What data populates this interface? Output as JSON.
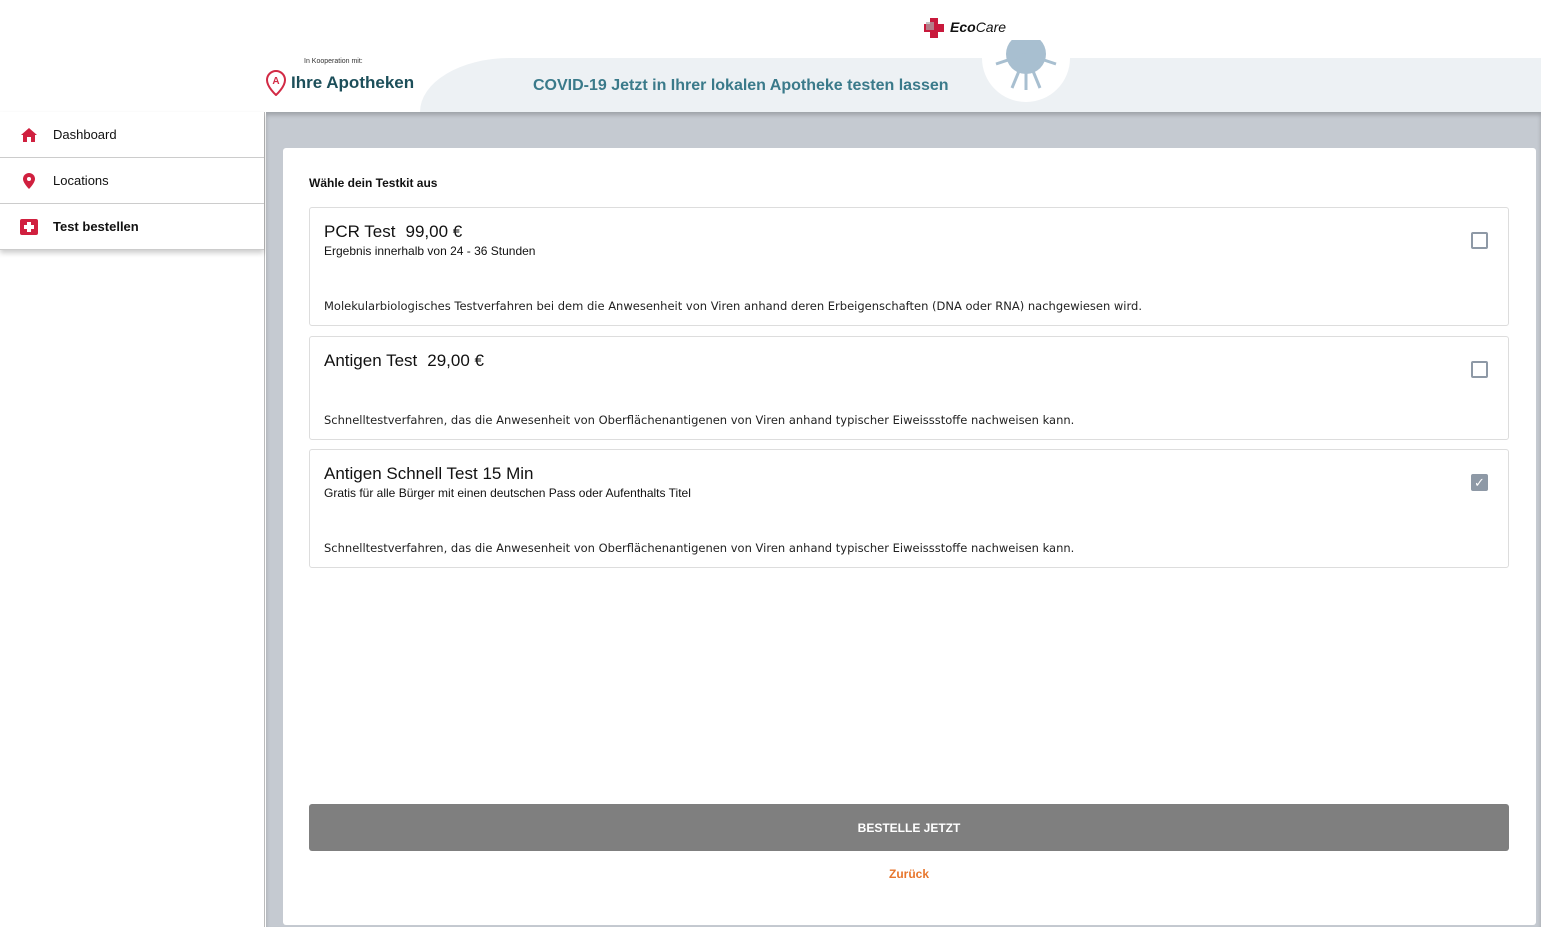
{
  "header": {
    "brand": "Eco",
    "brand2": "Care",
    "coop": "In Kooperation mit:",
    "partner": "Ihre Apotheken",
    "slogan": "COVID-19 Jetzt in Ihrer lokalen Apotheke testen lassen"
  },
  "sidebar": {
    "items": [
      {
        "label": "Dashboard"
      },
      {
        "label": "Locations"
      },
      {
        "label": "Test bestellen"
      }
    ]
  },
  "main": {
    "heading": "Wähle dein Testkit aus",
    "options": [
      {
        "name": "PCR Test",
        "price": "99,00 €",
        "subtitle": "Ergebnis innerhalb von 24 - 36 Stunden",
        "desc": "Molekularbiologisches Testverfahren bei dem die Anwesenheit von Viren anhand deren Erbeigenschaften (DNA oder RNA) nachgewiesen wird.",
        "checked": false
      },
      {
        "name": "Antigen Test",
        "price": "29,00 €",
        "subtitle": "",
        "desc": "Schnelltestverfahren, das die Anwesenheit von Oberflächenantigenen von Viren anhand typischer Eiweissstoffe nachweisen kann.",
        "checked": false
      },
      {
        "name": "Antigen Schnell Test 15 Min",
        "price": "",
        "subtitle": "Gratis für alle Bürger mit einen deutschen Pass oder Aufenthalts Titel",
        "desc": "Schnelltestverfahren, das die Anwesenheit von Oberflächenantigenen von Viren anhand typischer Eiweissstoffe nachweisen kann.",
        "checked": true
      }
    ],
    "order_button": "BESTELLE JETZT",
    "back_link": "Zurück"
  }
}
